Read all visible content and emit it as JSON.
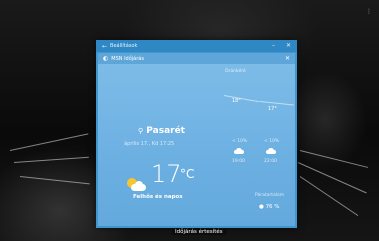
{
  "outer_window": {
    "back_icon": "back-arrow-icon",
    "title": "Beállítások",
    "minimize_icon": "minimize-icon",
    "close_icon": "close-icon"
  },
  "weather_window": {
    "title": "MSN Időjárás",
    "logo_icon": "msn-weather-icon",
    "close_icon": "close-icon",
    "location": "Pasarét",
    "location_icon": "location-pin-icon",
    "datetime": "április 17., Kd 17:25",
    "temperature": "17",
    "unit": "°C",
    "condition": "Felhős és napos",
    "condition_icon": "sun-cloud-icon",
    "hourly_label": "Óránként",
    "chart_points": [
      {
        "label": "18°"
      },
      {
        "label": "17°"
      }
    ],
    "forecast": [
      {
        "chance": "< 10%",
        "icon": "cloud-icon",
        "time": "19:00"
      },
      {
        "chance": "< 10%",
        "icon": "cloud-icon",
        "time": "22:00"
      }
    ],
    "humidity_label": "Páratartalom",
    "humidity_icon": "droplet-icon",
    "humidity_value": "76 %"
  },
  "taskbar": {
    "label": "Időjárás értesítés"
  },
  "colors": {
    "outer_window": "#3f97ce",
    "weather_background": "#7fbde8",
    "sun": "#f7c531"
  }
}
